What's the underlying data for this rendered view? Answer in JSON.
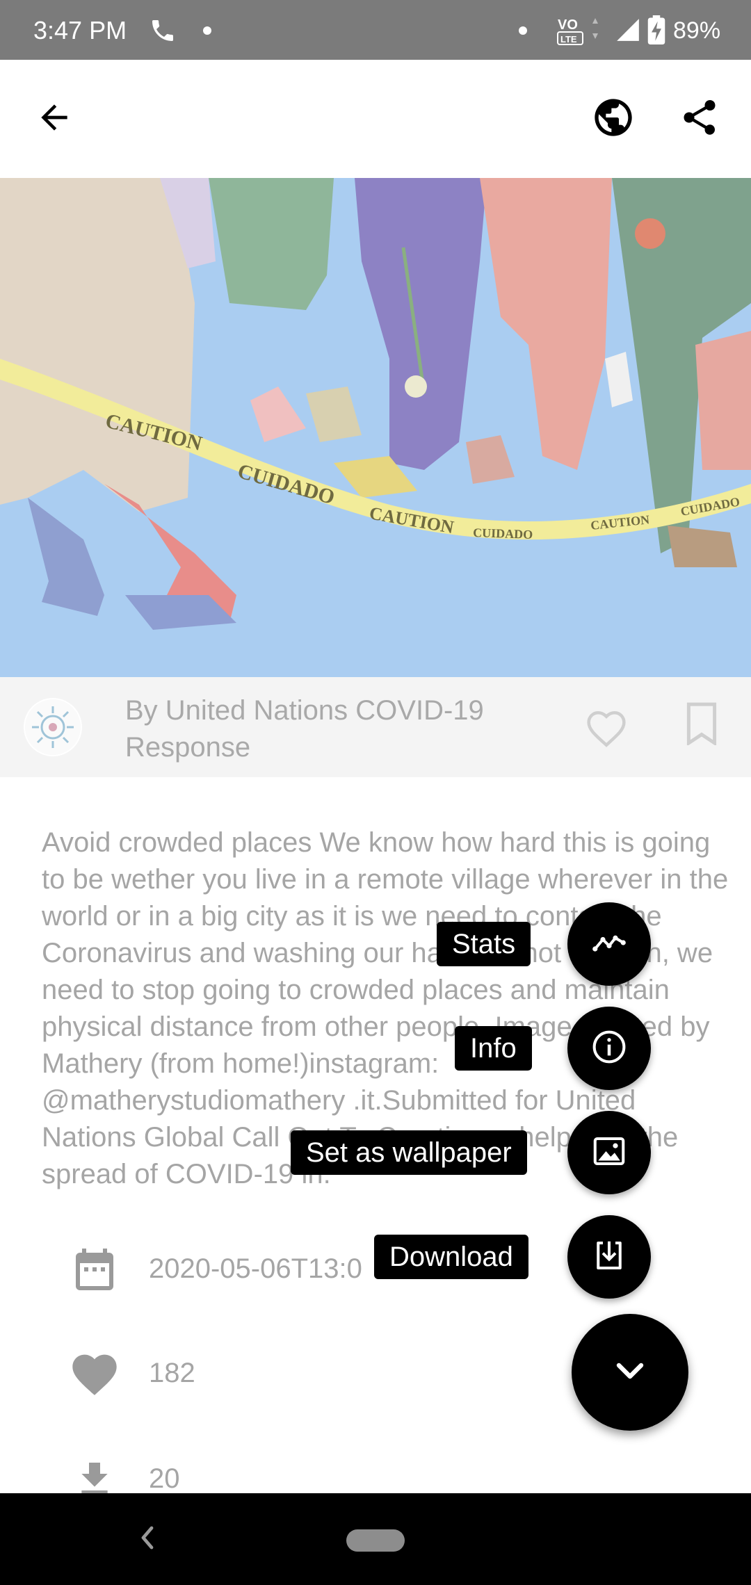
{
  "status_bar": {
    "time": "3:47 PM",
    "battery": "89%",
    "icons": [
      "phone-icon",
      "notification-dot",
      "volte-icon",
      "signal-icon",
      "battery-charging-icon"
    ]
  },
  "app_bar": {
    "icons": [
      "back-arrow-icon",
      "globe-icon",
      "share-icon"
    ]
  },
  "photo": {
    "description_icon": "photo-image"
  },
  "author": {
    "name": "By United Nations COVID-19 Response"
  },
  "description": "Avoid crowded places We know how hard this is going to be wether you live in a remote village wherever in the world or in a big city as it is we need to contain the Coronavirus and washing our hands is not enough, we need to stop going to crowded places and maintain physical distance from other people. Image created by Mathery (from home!)instagram: @matherystudiomathery .it.Submitted for United Nations Global Call Out To Creatives - help stop the spread of COVID-19 in.",
  "details": {
    "date": "2020-05-06T13:0",
    "likes": "182",
    "downloads": "20"
  },
  "fab_menu": {
    "stats_label": "Stats",
    "info_label": "Info",
    "wallpaper_label": "Set as wallpaper",
    "download_label": "Download"
  },
  "colors": {
    "status_bar": "#7b7b7b",
    "fab": "#000000",
    "dimmed_text": "#a5a5a5"
  }
}
